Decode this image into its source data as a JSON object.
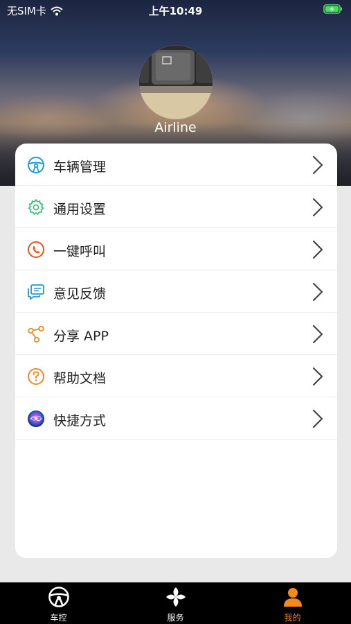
{
  "status_bar": {
    "carrier": "无SIM卡",
    "time": "上午10:49"
  },
  "profile": {
    "username": "Airline"
  },
  "menu": [
    {
      "label": "车辆管理",
      "icon": "steering-wheel-icon",
      "color": "#1e9be0"
    },
    {
      "label": "通用设置",
      "icon": "gear-icon",
      "color": "#2fbf6c"
    },
    {
      "label": "一键呼叫",
      "icon": "phone-icon",
      "color": "#e8531e"
    },
    {
      "label": "意见反馈",
      "icon": "feedback-icon",
      "color": "#2196d9"
    },
    {
      "label": "分享 APP",
      "icon": "share-icon",
      "color": "#f08a24"
    },
    {
      "label": "帮助文档",
      "icon": "help-icon",
      "color": "#f08a24"
    },
    {
      "label": "快捷方式",
      "icon": "siri-icon",
      "color": "#6a4cd6"
    }
  ],
  "tabs": [
    {
      "label": "车控",
      "icon": "steering-wheel-icon",
      "active": false
    },
    {
      "label": "服务",
      "icon": "clover-icon",
      "active": false
    },
    {
      "label": "我的",
      "icon": "person-icon",
      "active": true
    }
  ],
  "colors": {
    "accent": "#f28a1e",
    "tabbar_bg": "#000000",
    "card_bg": "#ffffff"
  }
}
